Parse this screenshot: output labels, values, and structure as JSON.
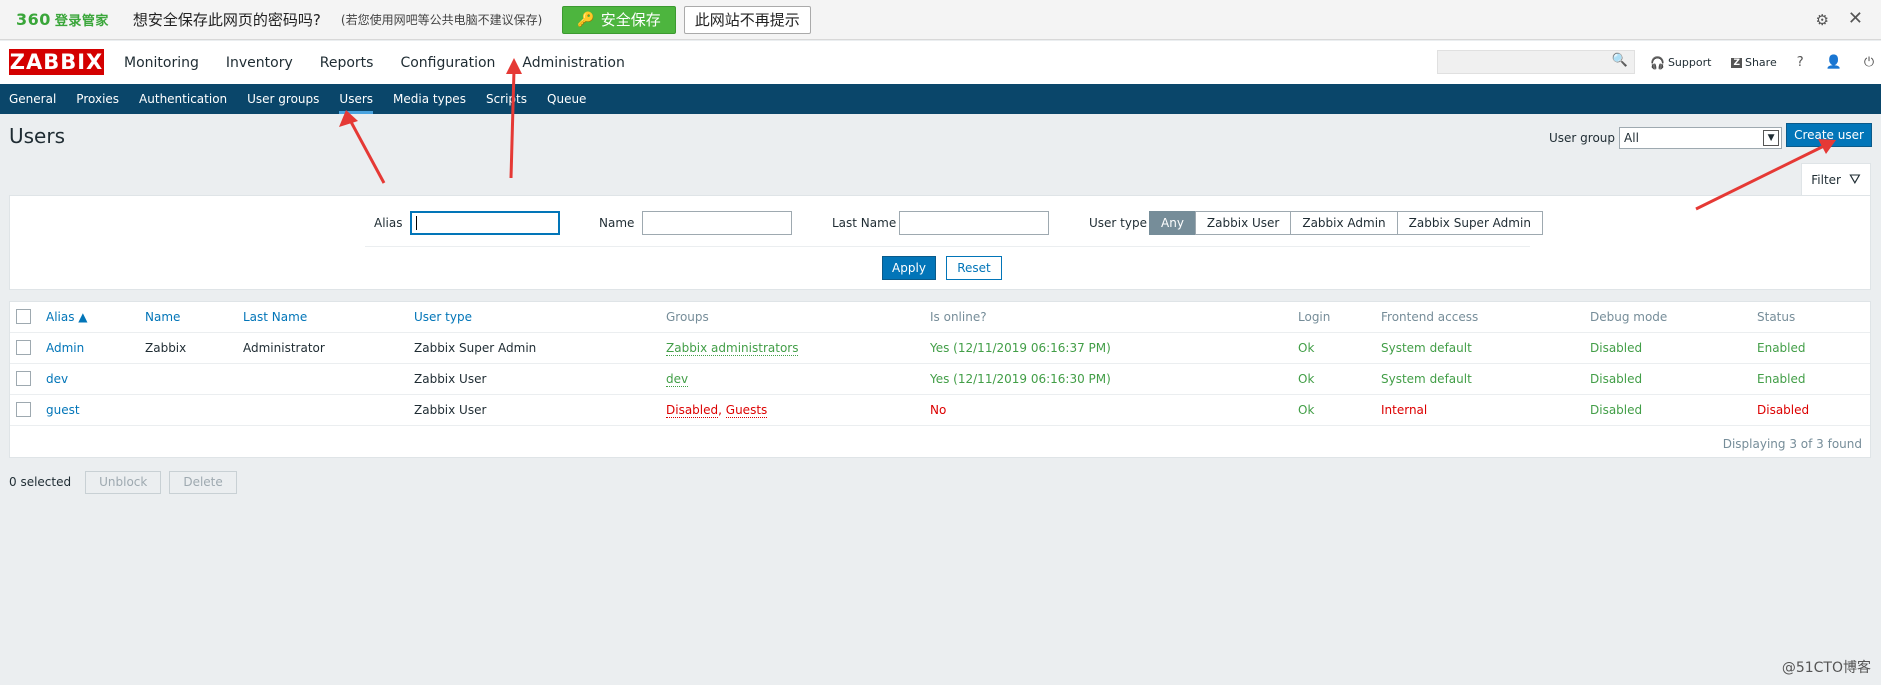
{
  "bar360": {
    "logo": "360",
    "logo_sub": "登录管家",
    "question": "想安全保存此网页的密码吗?",
    "hint": "(若您使用网吧等公共电脑不建议保存)",
    "save_label": "安全保存",
    "never_label": "此网站不再提示",
    "icons": [
      "key-icon",
      "gear-icon",
      "close-icon"
    ]
  },
  "topnav": {
    "logo": "ZABBIX",
    "menu": [
      "Monitoring",
      "Inventory",
      "Reports",
      "Configuration",
      "Administration"
    ],
    "support": "Support",
    "share": "Share",
    "icons": [
      "search-icon",
      "headset-icon",
      "share-icon",
      "help-icon",
      "user-icon",
      "power-icon"
    ]
  },
  "subnav": [
    "General",
    "Proxies",
    "Authentication",
    "User groups",
    "Users",
    "Media types",
    "Scripts",
    "Queue"
  ],
  "page": {
    "title": "Users",
    "user_group_label": "User group",
    "user_group_value": "All",
    "create_label": "Create user"
  },
  "filter": {
    "tab_label": "Filter",
    "alias_label": "Alias",
    "name_label": "Name",
    "lastname_label": "Last Name",
    "usertype_label": "User type",
    "usertypes": [
      "Any",
      "Zabbix User",
      "Zabbix Admin",
      "Zabbix Super Admin"
    ],
    "apply_label": "Apply",
    "reset_label": "Reset"
  },
  "table": {
    "headers": [
      "Alias ▲",
      "Name",
      "Last Name",
      "User type",
      "Groups",
      "Is online?",
      "Login",
      "Frontend access",
      "Debug mode",
      "Status"
    ],
    "rows": [
      {
        "alias": "Admin",
        "name": "Zabbix",
        "lastname": "Administrator",
        "usertype": "Zabbix Super Admin",
        "groups": "Zabbix administrators",
        "online": "Yes (12/11/2019 06:16:37 PM)",
        "login": "Ok",
        "frontend": "System default",
        "debug": "Disabled",
        "status": "Enabled"
      },
      {
        "alias": "dev",
        "name": "",
        "lastname": "",
        "usertype": "Zabbix User",
        "groups": "dev",
        "online": "Yes (12/11/2019 06:16:30 PM)",
        "login": "Ok",
        "frontend": "System default",
        "debug": "Disabled",
        "status": "Enabled"
      },
      {
        "alias": "guest",
        "name": "",
        "lastname": "",
        "usertype": "Zabbix User",
        "groups_a": "Disabled",
        "groups_b": "Guests",
        "online": "No",
        "login": "Ok",
        "frontend": "Internal",
        "debug": "Disabled",
        "status": "Disabled"
      }
    ],
    "displaying": "Displaying 3 of 3 found"
  },
  "footer": {
    "selected": "0 selected",
    "unblock": "Unblock",
    "delete": "Delete"
  },
  "watermark": "@51CTO博客",
  "colors": {
    "subnav_bg": "#0a466a",
    "primary": "#0275b8",
    "green": "#429e47",
    "red": "#dc0000",
    "logo_red": "#d40000",
    "annotation": "#e53935"
  }
}
